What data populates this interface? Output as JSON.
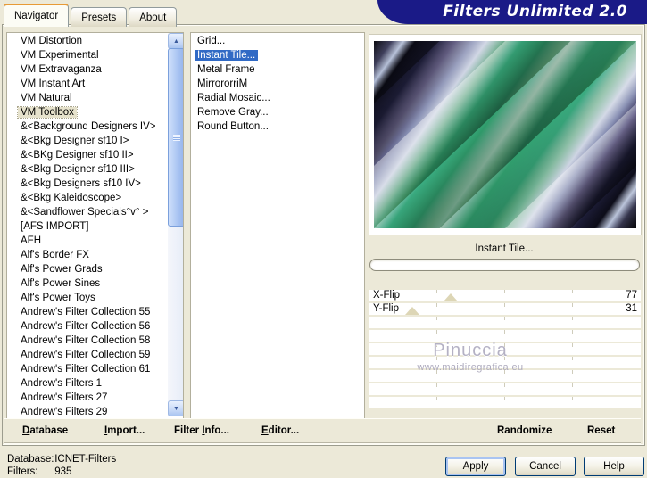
{
  "window": {
    "title": "Filters Unlimited 2.0"
  },
  "tabs": [
    {
      "label": "Navigator",
      "active": true
    },
    {
      "label": "Presets",
      "active": false
    },
    {
      "label": "About",
      "active": false
    }
  ],
  "category_list": {
    "items": [
      {
        "label": "VM Distortion"
      },
      {
        "label": "VM Experimental"
      },
      {
        "label": "VM Extravaganza"
      },
      {
        "label": "VM Instant Art"
      },
      {
        "label": "VM Natural"
      },
      {
        "label": "VM Toolbox",
        "selected": true
      },
      {
        "label": "&<Background Designers IV>"
      },
      {
        "label": "&<Bkg Designer sf10 I>"
      },
      {
        "label": "&<BKg Designer sf10 II>"
      },
      {
        "label": "&<Bkg Designer sf10 III>"
      },
      {
        "label": "&<Bkg Designers sf10 IV>"
      },
      {
        "label": "&<Bkg Kaleidoscope>"
      },
      {
        "label": "&<Sandflower Specials°v° >"
      },
      {
        "label": "[AFS IMPORT]"
      },
      {
        "label": "AFH"
      },
      {
        "label": "Alf's Border FX"
      },
      {
        "label": "Alf's Power Grads"
      },
      {
        "label": "Alf's Power Sines"
      },
      {
        "label": "Alf's Power Toys"
      },
      {
        "label": "Andrew's Filter Collection 55"
      },
      {
        "label": "Andrew's Filter Collection 56"
      },
      {
        "label": "Andrew's Filter Collection 58"
      },
      {
        "label": "Andrew's Filter Collection 59"
      },
      {
        "label": "Andrew's Filter Collection 61"
      },
      {
        "label": "Andrew's Filters 1"
      },
      {
        "label": "Andrew's Filters 27"
      },
      {
        "label": "Andrew's Filters 29"
      }
    ]
  },
  "filter_list": {
    "items": [
      {
        "label": "Grid..."
      },
      {
        "label": "Instant Tile...",
        "selected": true
      },
      {
        "label": "Metal Frame"
      },
      {
        "label": "MirrororriM"
      },
      {
        "label": "Radial Mosaic..."
      },
      {
        "label": "Remove Gray..."
      },
      {
        "label": "Round Button..."
      }
    ]
  },
  "preview": {
    "caption": "Instant Tile...",
    "watermark_name": "Pinuccia",
    "watermark_url": "www.maidiregrafica.eu"
  },
  "sliders": [
    {
      "label": "X-Flip",
      "value": "77",
      "handle_left": "30%"
    },
    {
      "label": "Y-Flip",
      "value": "31",
      "handle_left": "16%"
    }
  ],
  "command_bar": {
    "database": {
      "label": "Database",
      "mnemonic": 0
    },
    "import_cmd": {
      "label": "Import...",
      "mnemonic": 0
    },
    "filter_info": {
      "label": "Filter Info...",
      "mnemonic": 7
    },
    "editor": {
      "label": "Editor...",
      "mnemonic": 0
    },
    "randomize": {
      "label": "Randomize",
      "mnemonic": -1
    },
    "reset": {
      "label": "Reset",
      "mnemonic": -1
    }
  },
  "status": {
    "database_label": "Database:",
    "database_value": "ICNET-Filters",
    "filters_label": "Filters:",
    "filters_value": "935"
  },
  "footer_buttons": {
    "apply": "Apply",
    "cancel": "Cancel",
    "help": "Help"
  },
  "icons": {
    "scroll_up": "▲",
    "scroll_down": "▼"
  },
  "colors": {
    "banner": "#1a1a87",
    "selection": "#316ac5",
    "tab_accent": "#e79a36",
    "dialog_bg": "#ece9d8",
    "preview_palette": [
      "#08080c",
      "#b9c3da",
      "#17172c",
      "#575272",
      "#d8dde9",
      "#2f9168",
      "#86ac98"
    ]
  }
}
